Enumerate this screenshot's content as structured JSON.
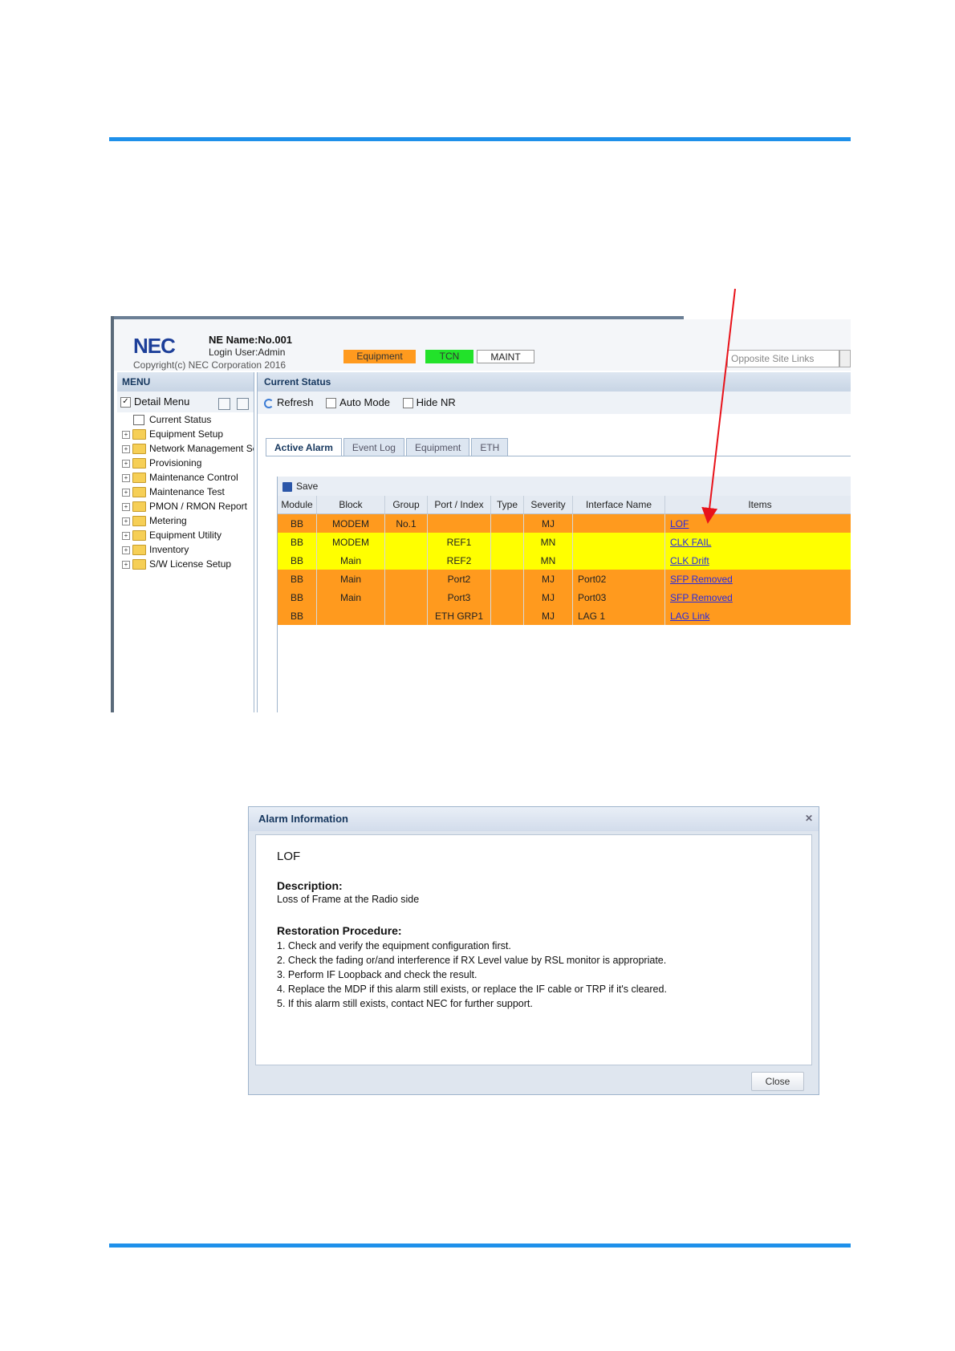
{
  "app": {
    "logo": "NEC",
    "ne_name": "NE Name:No.001",
    "login_user": "Login User:Admin",
    "copyright": "Copyright(c) NEC Corporation 2016",
    "status": {
      "equipment": "Equipment",
      "tcn": "TCN",
      "maint": "MAINT"
    },
    "opposite_site_placeholder": "Opposite Site Links",
    "colors": {
      "major": "#ff9a1e",
      "minor": "#ffff00",
      "tcn": "#22e22a",
      "rule": "#1e90ea"
    }
  },
  "menu": {
    "title": "MENU",
    "detail_menu": "Detail Menu",
    "current_status": "Current Status",
    "items": [
      "Equipment Setup",
      "Network Management Sett",
      "Provisioning",
      "Maintenance Control",
      "Maintenance Test",
      "PMON / RMON Report",
      "Metering",
      "Equipment Utility",
      "Inventory",
      "S/W License Setup"
    ]
  },
  "content": {
    "title": "Current Status",
    "toolbar": {
      "refresh": "Refresh",
      "auto_mode": "Auto Mode",
      "hide_nr": "Hide NR"
    },
    "tabs": [
      "Active Alarm",
      "Event Log",
      "Equipment",
      "ETH"
    ],
    "save": "Save",
    "columns": [
      "Module",
      "Block",
      "Group",
      "Port / Index",
      "Type",
      "Severity",
      "Interface Name",
      "Items"
    ],
    "rows": [
      {
        "module": "BB",
        "block": "MODEM",
        "group": "No.1",
        "port": "",
        "type": "",
        "severity": "MJ",
        "iface": "",
        "item": "LOF"
      },
      {
        "module": "BB",
        "block": "MODEM",
        "group": "",
        "port": "REF1",
        "type": "",
        "severity": "MN",
        "iface": "",
        "item": "CLK FAIL"
      },
      {
        "module": "BB",
        "block": "Main",
        "group": "",
        "port": "REF2",
        "type": "",
        "severity": "MN",
        "iface": "",
        "item": "CLK Drift"
      },
      {
        "module": "BB",
        "block": "Main",
        "group": "",
        "port": "Port2",
        "type": "",
        "severity": "MJ",
        "iface": "Port02",
        "item": "SFP Removed"
      },
      {
        "module": "BB",
        "block": "Main",
        "group": "",
        "port": "Port3",
        "type": "",
        "severity": "MJ",
        "iface": "Port03",
        "item": "SFP Removed"
      },
      {
        "module": "BB",
        "block": "",
        "group": "",
        "port": "ETH GRP1",
        "type": "",
        "severity": "MJ",
        "iface": "LAG 1",
        "item": "LAG Link"
      }
    ]
  },
  "dialog": {
    "title": "Alarm Information",
    "alarm": "LOF",
    "description_heading": "Description:",
    "description": "Loss of Frame at the Radio side",
    "procedure_heading": "Restoration Procedure:",
    "steps": [
      "1. Check and verify the equipment configuration first.",
      "2. Check the fading or/and interference if RX Level value by RSL monitor is appropriate.",
      "3. Perform IF Loopback and check the result.",
      "4. Replace the MDP if this alarm still exists, or replace the IF cable or TRP if it's cleared.",
      "5. If this alarm still exists, contact NEC for further support."
    ],
    "close": "Close"
  }
}
